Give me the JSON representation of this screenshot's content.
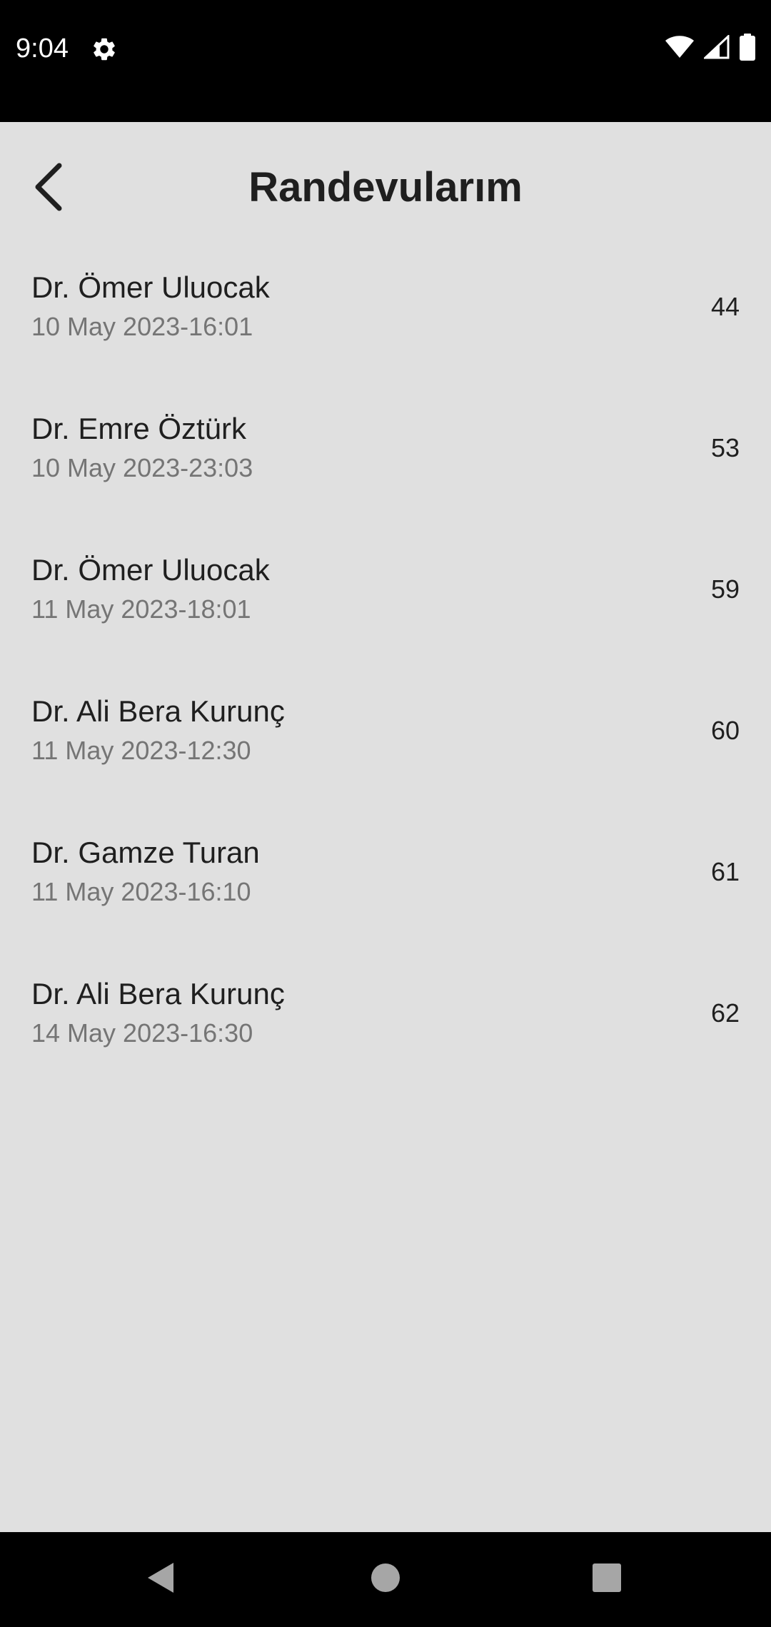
{
  "status_bar": {
    "time": "9:04",
    "icons": [
      "gear-icon",
      "wifi-icon",
      "signal-icon",
      "battery-icon"
    ]
  },
  "app_bar": {
    "back_icon": "chevron-left-icon",
    "title": "Randevularım"
  },
  "appointments": [
    {
      "doctor": "Dr. Ömer Uluocak",
      "datetime": "10 May 2023-16:01",
      "id": "44"
    },
    {
      "doctor": "Dr. Emre Öztürk",
      "datetime": "10 May 2023-23:03",
      "id": "53"
    },
    {
      "doctor": "Dr. Ömer Uluocak",
      "datetime": "11 May 2023-18:01",
      "id": "59"
    },
    {
      "doctor": "Dr. Ali Bera Kurunç",
      "datetime": "11 May 2023-12:30",
      "id": "60"
    },
    {
      "doctor": "Dr. Gamze Turan",
      "datetime": "11 May 2023-16:10",
      "id": "61"
    },
    {
      "doctor": "Dr. Ali Bera Kurunç",
      "datetime": "14 May 2023-16:30",
      "id": "62"
    }
  ],
  "nav_bar": {
    "icons": [
      "back-triangle-icon",
      "home-circle-icon",
      "recents-square-icon"
    ]
  },
  "colors": {
    "background": "#e0e0e0",
    "system_bars": "#000000",
    "primary_text": "#1f1f1f",
    "secondary_text": "#757575",
    "nav_icon": "#a6a6a6"
  }
}
